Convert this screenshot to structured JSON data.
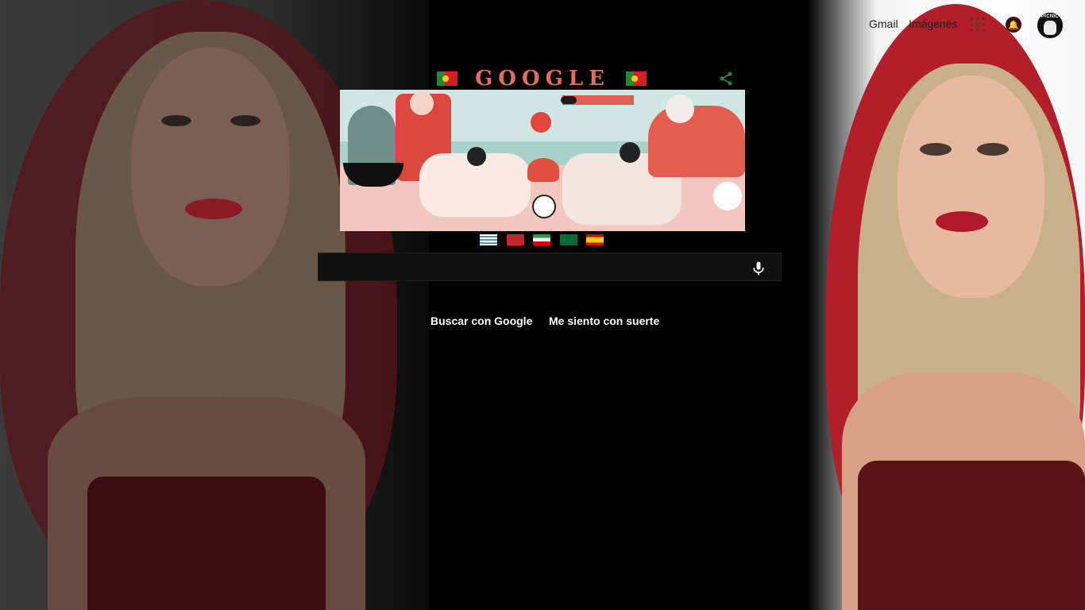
{
  "header": {
    "gmail_label": "Gmail",
    "images_label": "Imágenes",
    "avatar_text": "PICNIC"
  },
  "doodle": {
    "title": "GOOGLE",
    "flags": [
      "uruguay",
      "morocco",
      "iran",
      "saudi-arabia",
      "spain"
    ]
  },
  "search": {
    "value": "",
    "placeholder": ""
  },
  "buttons": {
    "search_label": "Buscar con Google",
    "lucky_label": "Me siento con suerte"
  },
  "colors": {
    "doodle_accent": "#e0705e",
    "share_icon": "#1e8b4c",
    "portugal_green": "#1d8a3a",
    "portugal_red": "#d51e2a"
  }
}
